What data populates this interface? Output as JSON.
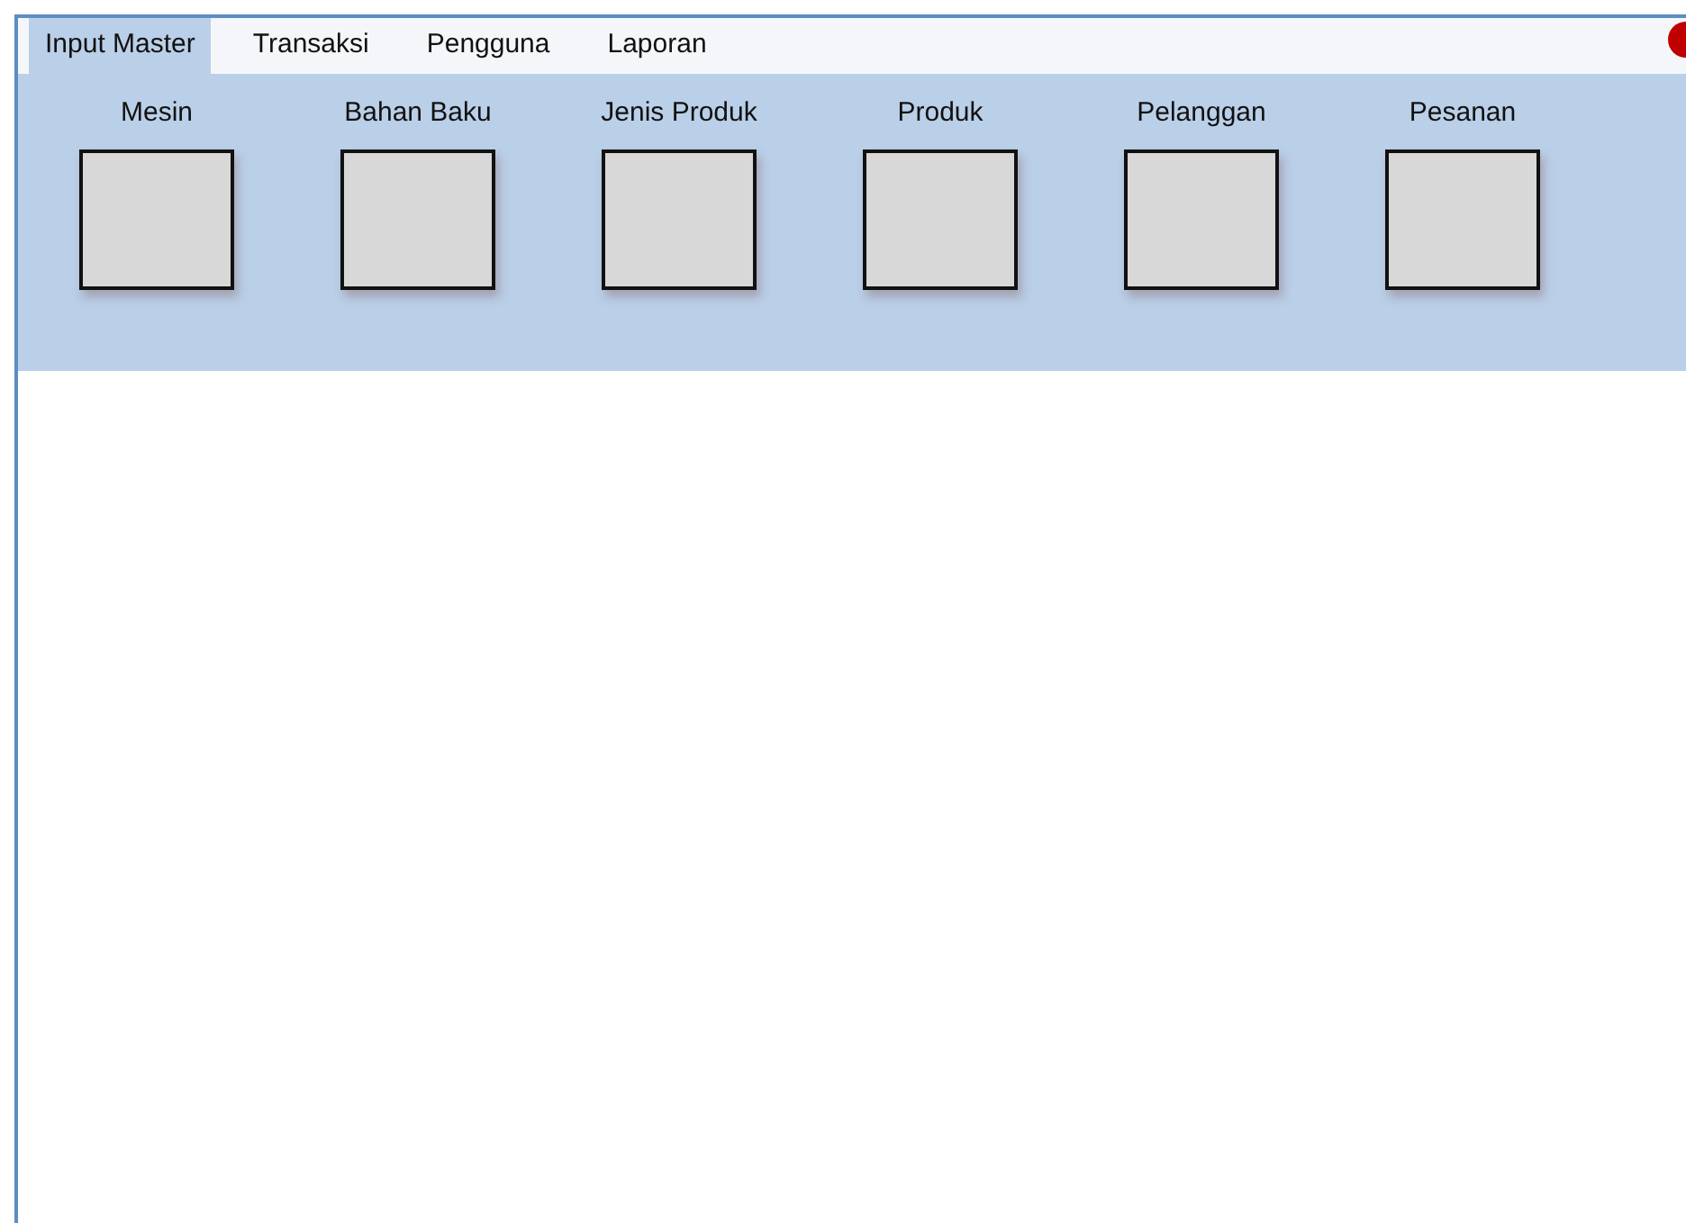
{
  "tabs": [
    {
      "label": "Input Master",
      "selected": true
    },
    {
      "label": "Transaksi",
      "selected": false
    },
    {
      "label": "Pengguna",
      "selected": false
    },
    {
      "label": "Laporan",
      "selected": false
    }
  ],
  "ribbon": {
    "items": [
      {
        "label": "Mesin"
      },
      {
        "label": "Bahan Baku"
      },
      {
        "label": "Jenis Produk"
      },
      {
        "label": "Produk"
      },
      {
        "label": "Pelanggan"
      },
      {
        "label": "Pesanan"
      }
    ]
  }
}
